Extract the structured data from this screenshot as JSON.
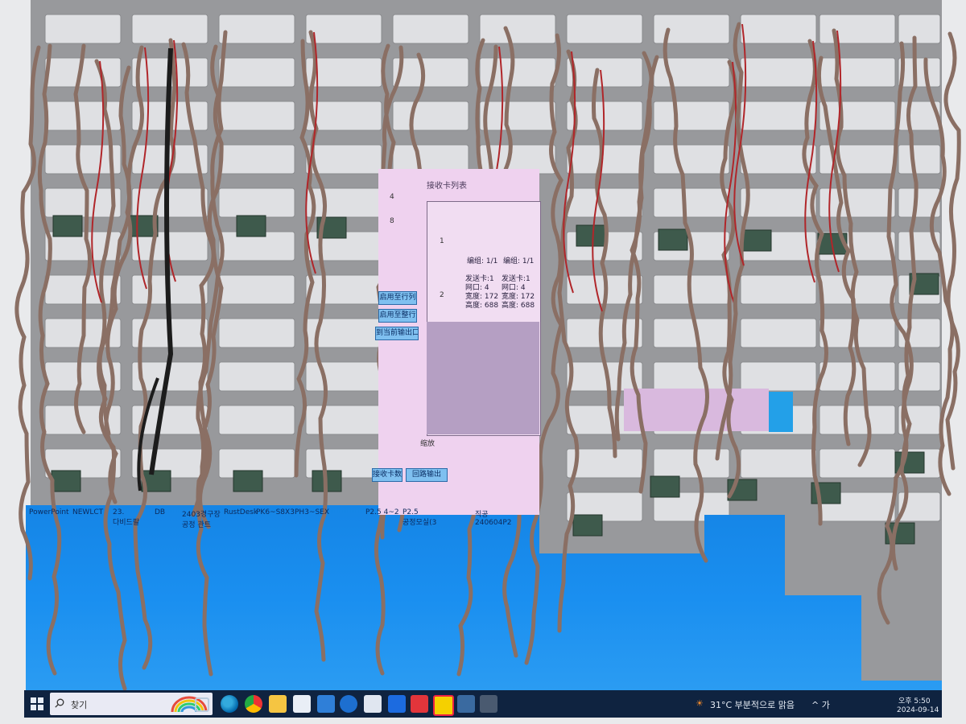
{
  "app_window": {
    "title": "接收卡列表",
    "side_numbers": [
      "4",
      "8"
    ],
    "row_labels": [
      "1",
      "2"
    ],
    "col_headers": [
      "编组: 1/1",
      "编组: 1/1"
    ],
    "cell_info_left": "发送卡:1\n网口: 4\n宽度: 172\n高度: 688",
    "cell_info_right": "发送卡:1\n网口: 4\n宽度: 172\n高度: 688",
    "buttons": [
      "启用至行列",
      "启用至整行",
      "到当前输出口"
    ],
    "bottom_buttons": [
      "接收卡数量",
      "回路输出"
    ],
    "scroll_label": "缩放"
  },
  "desktop_labels": [
    "PowerPoint",
    "NEWLCT",
    "23.\n다비드팔",
    "DB",
    "2403경구장\n공정 관트",
    "RustDesk",
    "PK6~S8X3",
    "PH3~SEX",
    "P2.5 4~2",
    "P2.5\n공정모실(3",
    "직공\n240604P2"
  ],
  "taskbar": {
    "search_placeholder": "찾기",
    "weather": "31°C  부분적으로 맑음",
    "tray_text": "^ 가",
    "time": "오후 5:50",
    "date": "2024-09-14"
  },
  "colors": {
    "frame": "#98999c",
    "ribbon_cable": "#8a6f64",
    "red_wire": "#b0262a",
    "pcb": "#3e5a4c",
    "led_blue": "#1a8fe8",
    "window_purple": "#efd2ef",
    "taskbar": "#0f2340"
  }
}
